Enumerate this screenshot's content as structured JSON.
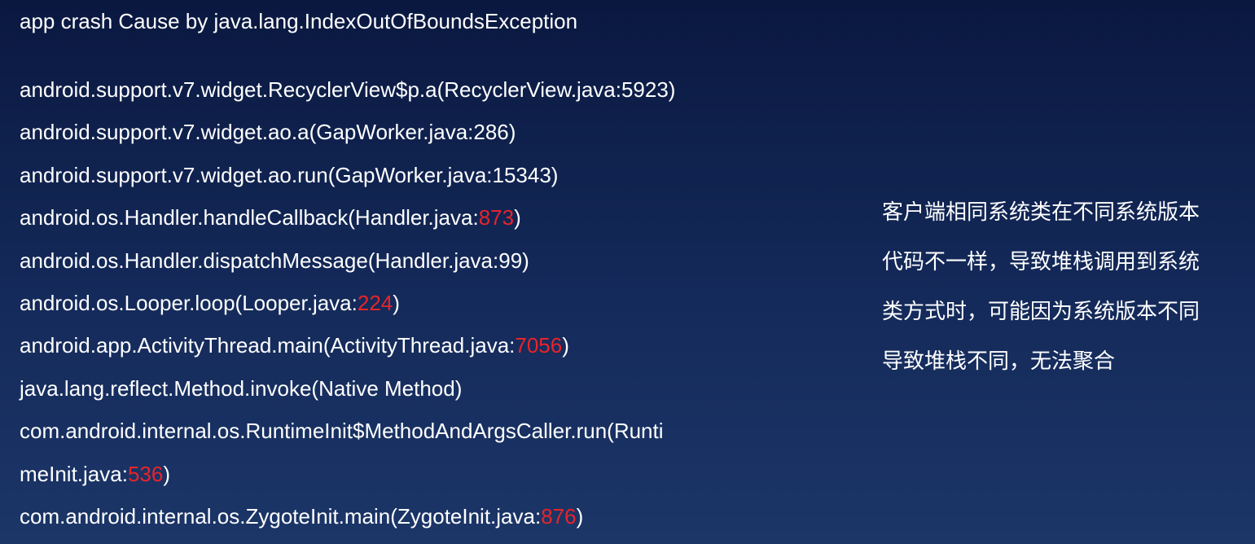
{
  "title": "app crash Cause by java.lang.IndexOutOfBoundsException",
  "stack_lines": [
    {
      "text": "android.support.v7.widget.RecyclerView$p.a(RecyclerView.java:5923)",
      "num": "",
      "suffix": ""
    },
    {
      "text": "android.support.v7.widget.ao.a(GapWorker.java:286)",
      "num": "",
      "suffix": ""
    },
    {
      "text": "android.support.v7.widget.ao.run(GapWorker.java:15343)",
      "num": "",
      "suffix": ""
    },
    {
      "text": "android.os.Handler.handleCallback(Handler.java:",
      "num": "873",
      "suffix": ")"
    },
    {
      "text": "android.os.Handler.dispatchMessage(Handler.java:99)",
      "num": "",
      "suffix": ""
    },
    {
      "text": "android.os.Looper.loop(Looper.java:",
      "num": "224",
      "suffix": ")"
    },
    {
      "text": "android.app.ActivityThread.main(ActivityThread.java:",
      "num": "7056",
      "suffix": ")"
    },
    {
      "text": "java.lang.reflect.Method.invoke(Native Method)",
      "num": "",
      "suffix": ""
    },
    {
      "text": "com.android.internal.os.RuntimeInit$MethodAndArgsCaller.run(Runti",
      "num": "",
      "suffix": ""
    },
    {
      "text": "meInit.java:",
      "num": "536",
      "suffix": ")"
    },
    {
      "text": "com.android.internal.os.ZygoteInit.main(ZygoteInit.java:",
      "num": "876",
      "suffix": ")"
    }
  ],
  "note_lines": [
    "客户端相同系统类在不同系统版本",
    "代码不一样，导致堆栈调用到系统",
    "类方式时，可能因为系统版本不同",
    "导致堆栈不同，无法聚合"
  ],
  "colors": {
    "background_top": "#0a1840",
    "background_bottom": "#1c3668",
    "text": "#ffffff",
    "highlight": "#e8242a"
  }
}
